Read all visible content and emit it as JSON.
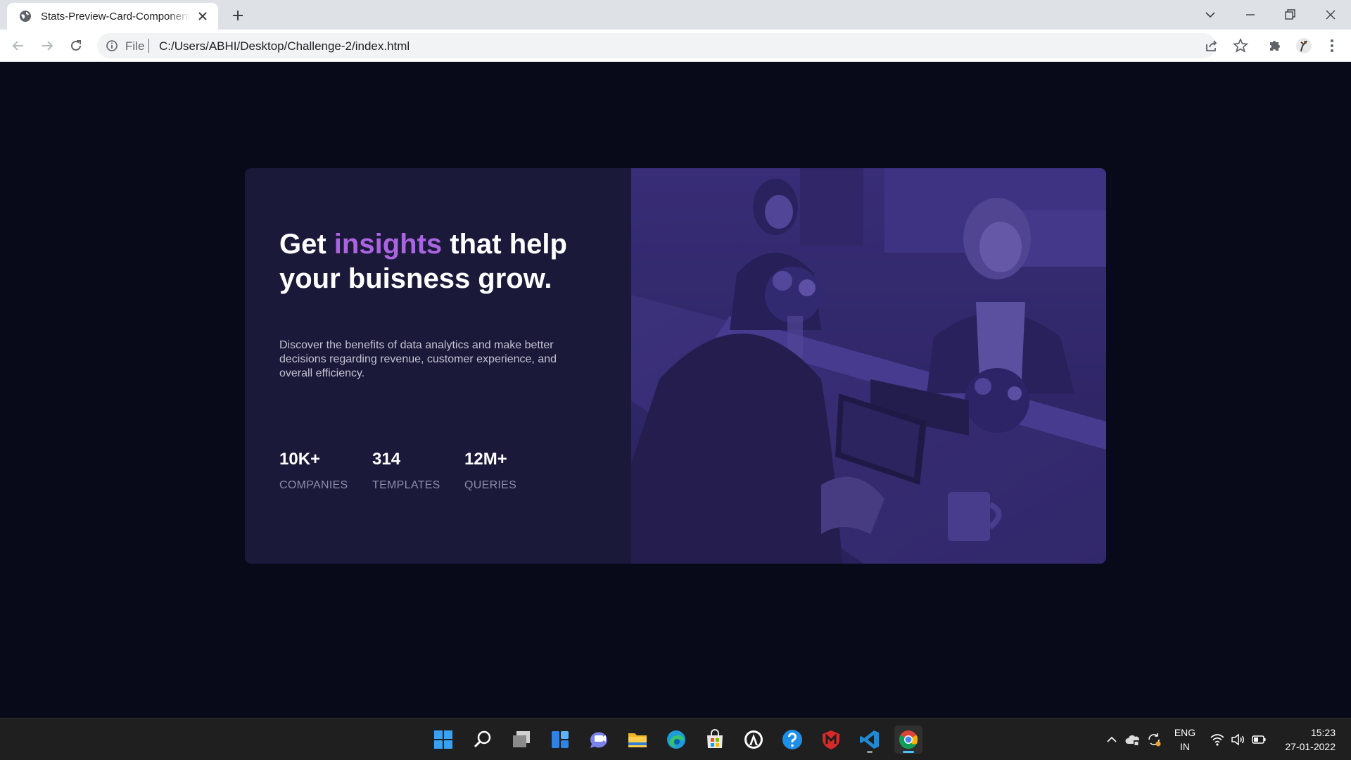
{
  "browser": {
    "tab_title": "Stats-Preview-Card-Component-",
    "address": {
      "scheme_label": "File",
      "url": "C:/Users/ABHI/Desktop/Challenge-2/index.html"
    }
  },
  "card": {
    "headline_part1": "Get ",
    "headline_accent": "insights",
    "headline_part2": " that help your buisness grow.",
    "description": "Discover the benefits of data analytics and make better decisions regarding revenue, customer experience, and overall efficiency.",
    "stats": [
      {
        "value": "10K+",
        "label": "COMPANIES"
      },
      {
        "value": "314",
        "label": "TEMPLATES"
      },
      {
        "value": "12M+",
        "label": "QUERIES"
      }
    ]
  },
  "taskbar": {
    "apps": [
      "start",
      "search",
      "task-view",
      "widgets",
      "chat",
      "file-explorer",
      "edge",
      "microsoft-store",
      "app-circle",
      "help",
      "mcafee",
      "vscode",
      "chrome"
    ],
    "tray": {
      "lang_line1": "ENG",
      "lang_line2": "IN",
      "time": "15:23",
      "date": "27-01-2022"
    }
  },
  "colors": {
    "page_background": "#080a1a",
    "card_background": "#1b1939",
    "accent": "#a964e0",
    "photo_tint": "#3f3488",
    "stat_label": "#8d8ca8"
  }
}
